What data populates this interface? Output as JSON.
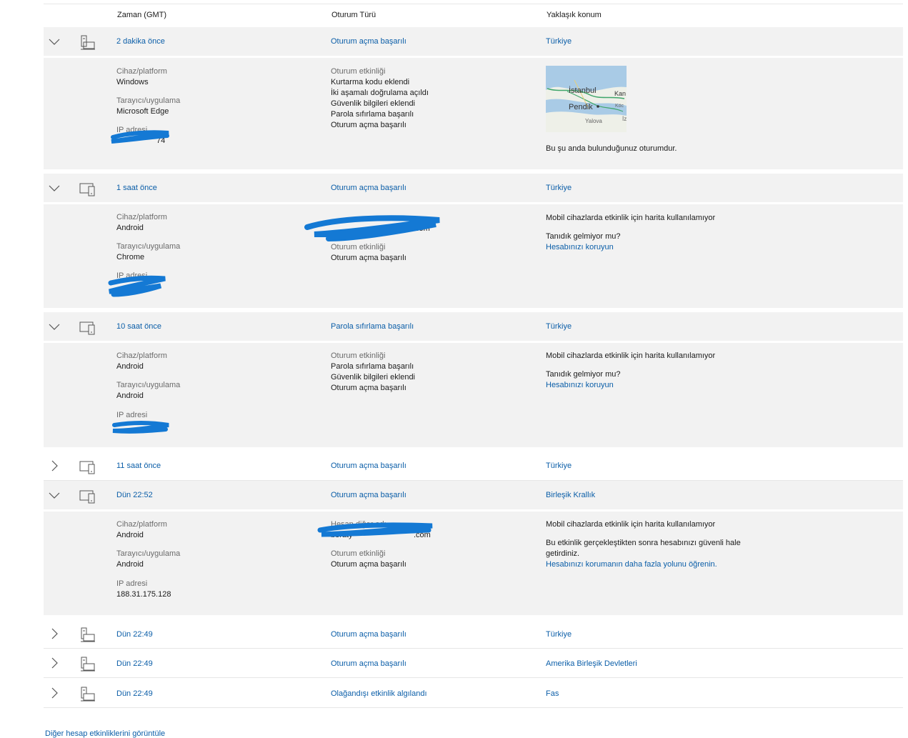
{
  "header": {
    "time_col": "Zaman (GMT)",
    "type_col": "Oturum Türü",
    "location_col": "Yaklaşık konum"
  },
  "rows": [
    {
      "time": "2 dakika önce",
      "type": "Oturum açma başarılı",
      "location": "Türkiye",
      "expanded": true,
      "device_icon": "desktop-icon",
      "details": {
        "device_label": "Cihaz/platform",
        "device_value": "Windows",
        "browser_label": "Tarayıcı/uygulama",
        "browser_value": "Microsoft Edge",
        "ip_label": "IP adresi",
        "ip_value": "74",
        "activity_label": "Oturum etkinliği",
        "activities": [
          "Kurtarma kodu eklendi",
          "İki aşamalı doğrulama açıldı",
          "Güvenlik bilgileri eklendi",
          "Parola sıfırlama başarılı",
          "Oturum açma başarılı"
        ],
        "map": {
          "city1": "İstanbul",
          "city2": "Pendik",
          "city3": "Yalova",
          "edge1": "Kan",
          "edge2": "Köc",
          "edge3": "İz"
        },
        "location_note": "Bu şu anda bulunduğunuz oturumdur."
      }
    },
    {
      "time": "1 saat önce",
      "type": "Oturum açma başarılı",
      "location": "Türkiye",
      "expanded": true,
      "device_icon": "mobile-icon",
      "details": {
        "device_label": "Cihaz/platform",
        "device_value": "Android",
        "browser_label": "Tarayıcı/uygulama",
        "browser_value": "Chrome",
        "ip_label": "IP adresi",
        "ip_value": "",
        "alias_value": "com",
        "activity_label": "Oturum etkinliği",
        "activities": [
          "Oturum açma başarılı"
        ],
        "map_note": "Mobil cihazlarda etkinlik için harita kullanılamıyor",
        "question": "Tanıdık gelmiyor mu?",
        "protect_link": "Hesabınızı koruyun"
      }
    },
    {
      "time": "10 saat önce",
      "type": "Parola sıfırlama başarılı",
      "location": "Türkiye",
      "expanded": true,
      "device_icon": "mobile-icon",
      "details": {
        "device_label": "Cihaz/platform",
        "device_value": "Android",
        "browser_label": "Tarayıcı/uygulama",
        "browser_value": "Android",
        "ip_label": "IP adresi",
        "ip_value": "",
        "activity_label": "Oturum etkinliği",
        "activities": [
          "Parola sıfırlama başarılı",
          "Güvenlik bilgileri eklendi",
          "Oturum açma başarılı"
        ],
        "map_note": "Mobil cihazlarda etkinlik için harita kullanılamıyor",
        "question": "Tanıdık gelmiyor mu?",
        "protect_link": "Hesabınızı koruyun"
      }
    },
    {
      "time": "11 saat önce",
      "type": "Oturum açma başarılı",
      "location": "Türkiye",
      "expanded": false,
      "device_icon": "mobile-icon"
    },
    {
      "time": "Dün 22:52",
      "type": "Oturum açma başarılı",
      "location": "Birleşik Krallık",
      "expanded": true,
      "device_icon": "mobile-icon",
      "details": {
        "device_label": "Cihaz/platform",
        "device_value": "Android",
        "browser_label": "Tarayıcı/uygulama",
        "browser_value": "Android",
        "ip_label": "IP adresi",
        "ip_value": "188.31.175.128",
        "alias_label": "Hesap diğer adı",
        "alias_value": "beraty",
        "alias_suffix": ".com",
        "activity_label": "Oturum etkinliği",
        "activities": [
          "Oturum açma başarılı"
        ],
        "map_note": "Mobil cihazlarda etkinlik için harita kullanılamıyor",
        "secure_note_1": "Bu etkinlik gerçekleştikten sonra hesabınızı güvenli hale",
        "secure_note_2": "getirdiniz.",
        "more_link": "Hesabınızı korumanın daha fazla yolunu öğrenin."
      }
    },
    {
      "time": "Dün 22:49",
      "type": "Oturum açma başarılı",
      "location": "Türkiye",
      "expanded": false,
      "device_icon": "desktop-icon"
    },
    {
      "time": "Dün 22:49",
      "type": "Oturum açma başarılı",
      "location": "Amerika Birleşik Devletleri",
      "expanded": false,
      "device_icon": "desktop-icon"
    },
    {
      "time": "Dün 22:49",
      "type": "Olağandışı etkinlik algılandı",
      "location": "Fas",
      "expanded": false,
      "device_icon": "desktop-icon"
    }
  ],
  "footer": {
    "more_activity_link": "Diğer hesap etkinliklerini görüntüle"
  }
}
